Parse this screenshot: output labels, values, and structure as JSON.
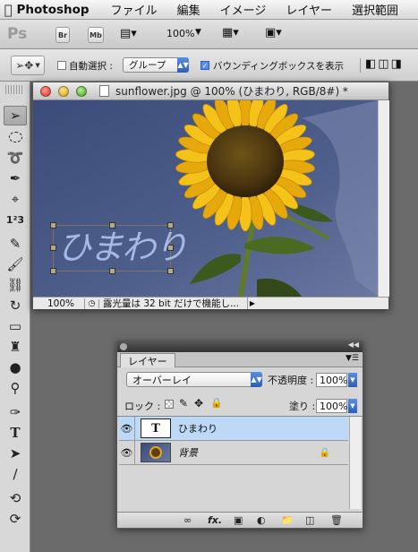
{
  "menubar": {
    "app_name": "Photoshop",
    "items": [
      "ファイル",
      "編集",
      "イメージ",
      "レイヤー",
      "選択範囲"
    ]
  },
  "appbar": {
    "logo": "Ps",
    "bridge_label": "Br",
    "minibridge_label": "Mb",
    "zoom_value": "100%"
  },
  "options": {
    "auto_select_label": "自動選択 :",
    "auto_select_checked": false,
    "auto_select_mode": "グループ",
    "bounding_box_label": "バウンディングボックスを表示",
    "bounding_box_checked": true
  },
  "document": {
    "title": "sunflower.jpg @ 100% (ひまわり, RGB/8#) *",
    "canvas_text": "ひまわり",
    "zoom": "100%",
    "status_text": "露光量は 32 bit だけで機能し..."
  },
  "layers_panel": {
    "tab_label": "レイヤー",
    "blend_mode": "オーバーレイ",
    "opacity_label": "不透明度 :",
    "opacity_value": "100%",
    "lock_label": "ロック :",
    "fill_label": "塗り :",
    "fill_value": "100%",
    "layers": [
      {
        "thumb_label": "T",
        "name": "ひまわり",
        "selected": true
      },
      {
        "name": "背景",
        "selected": false
      }
    ],
    "footer_fx_label": "fx."
  },
  "colors": {
    "layer_selected": "#bcd9f8",
    "sky": "#4a5a86",
    "petal": "#f2b510",
    "text_overlay": "#9bb0e0"
  }
}
